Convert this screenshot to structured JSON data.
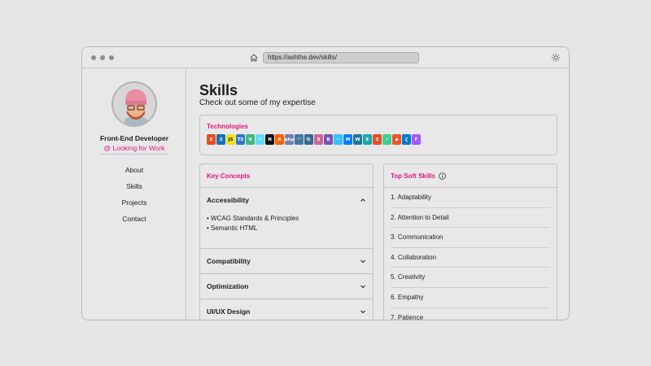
{
  "browser": {
    "url": "https://ashthe.dev/skills/",
    "icons": [
      "home-icon",
      "sun-icon"
    ]
  },
  "sidebar": {
    "role": "Front-End Developer",
    "status": "@ Looking for Work",
    "nav": [
      {
        "label": "About"
      },
      {
        "label": "Skills"
      },
      {
        "label": "Projects"
      },
      {
        "label": "Contact"
      }
    ]
  },
  "main": {
    "title": "Skills",
    "subtitle": "Check out some of my expertise"
  },
  "technologies": {
    "title": "Technologies",
    "icons": [
      {
        "name": "html5-icon",
        "glyph": "5",
        "color": "#e34f26"
      },
      {
        "name": "css3-icon",
        "glyph": "3",
        "color": "#1572b6"
      },
      {
        "name": "javascript-icon",
        "glyph": "JS",
        "color": "#f7df1e"
      },
      {
        "name": "typescript-icon",
        "glyph": "TS",
        "color": "#3178c6"
      },
      {
        "name": "vue-icon",
        "glyph": "V",
        "color": "#41b883"
      },
      {
        "name": "react-icon",
        "glyph": "⚛",
        "color": "#61dafb"
      },
      {
        "name": "nextjs-icon",
        "glyph": "N",
        "color": "#111111"
      },
      {
        "name": "astro-icon",
        "glyph": "A",
        "color": "#ff5d01"
      },
      {
        "name": "php-icon",
        "glyph": "php",
        "color": "#777bb4"
      },
      {
        "name": "mysql-icon",
        "glyph": "◠",
        "color": "#4479a1"
      },
      {
        "name": "postgresql-icon",
        "glyph": "🐘",
        "color": "#336791"
      },
      {
        "name": "sass-icon",
        "glyph": "S",
        "color": "#cc6699"
      },
      {
        "name": "bootstrap-icon",
        "glyph": "B",
        "color": "#7952b3"
      },
      {
        "name": "tailwind-icon",
        "glyph": "~",
        "color": "#38bdf8"
      },
      {
        "name": "mui-icon",
        "glyph": "M",
        "color": "#007fff"
      },
      {
        "name": "wordpress-icon",
        "glyph": "W",
        "color": "#21759b"
      },
      {
        "name": "elementor-icon",
        "glyph": "E",
        "color": "#1fa5a6"
      },
      {
        "name": "shopify-icon",
        "glyph": "S",
        "color": "#e44d26"
      },
      {
        "name": "supabase-icon",
        "glyph": "⚡",
        "color": "#3ecf8e"
      },
      {
        "name": "git-icon",
        "glyph": "◆",
        "color": "#f05032"
      },
      {
        "name": "vscode-icon",
        "glyph": "❮",
        "color": "#007acc"
      },
      {
        "name": "figma-icon",
        "glyph": "F",
        "color": "#a259ff"
      }
    ]
  },
  "concepts": {
    "title": "Key Concepts",
    "items": [
      {
        "label": "Accessibility",
        "expanded": true,
        "details": [
          "• WCAG Standards & Principles",
          "• Semantic HTML"
        ]
      },
      {
        "label": "Compatibility",
        "expanded": false
      },
      {
        "label": "Optimization",
        "expanded": false
      },
      {
        "label": "UI/UX Design",
        "expanded": false
      }
    ]
  },
  "soft_skills": {
    "title": "Top Soft Skills",
    "items": [
      {
        "label": "1. Adaptability"
      },
      {
        "label": "2. Attention to Detail"
      },
      {
        "label": "3. Communication"
      },
      {
        "label": "4. Collaboration"
      },
      {
        "label": "5. Creativity"
      },
      {
        "label": "6. Empathy"
      },
      {
        "label": "7. Patience"
      }
    ]
  },
  "colors": {
    "accent": "#e3167b",
    "background": "#e7e6e6",
    "border": "#c4c3c3"
  }
}
